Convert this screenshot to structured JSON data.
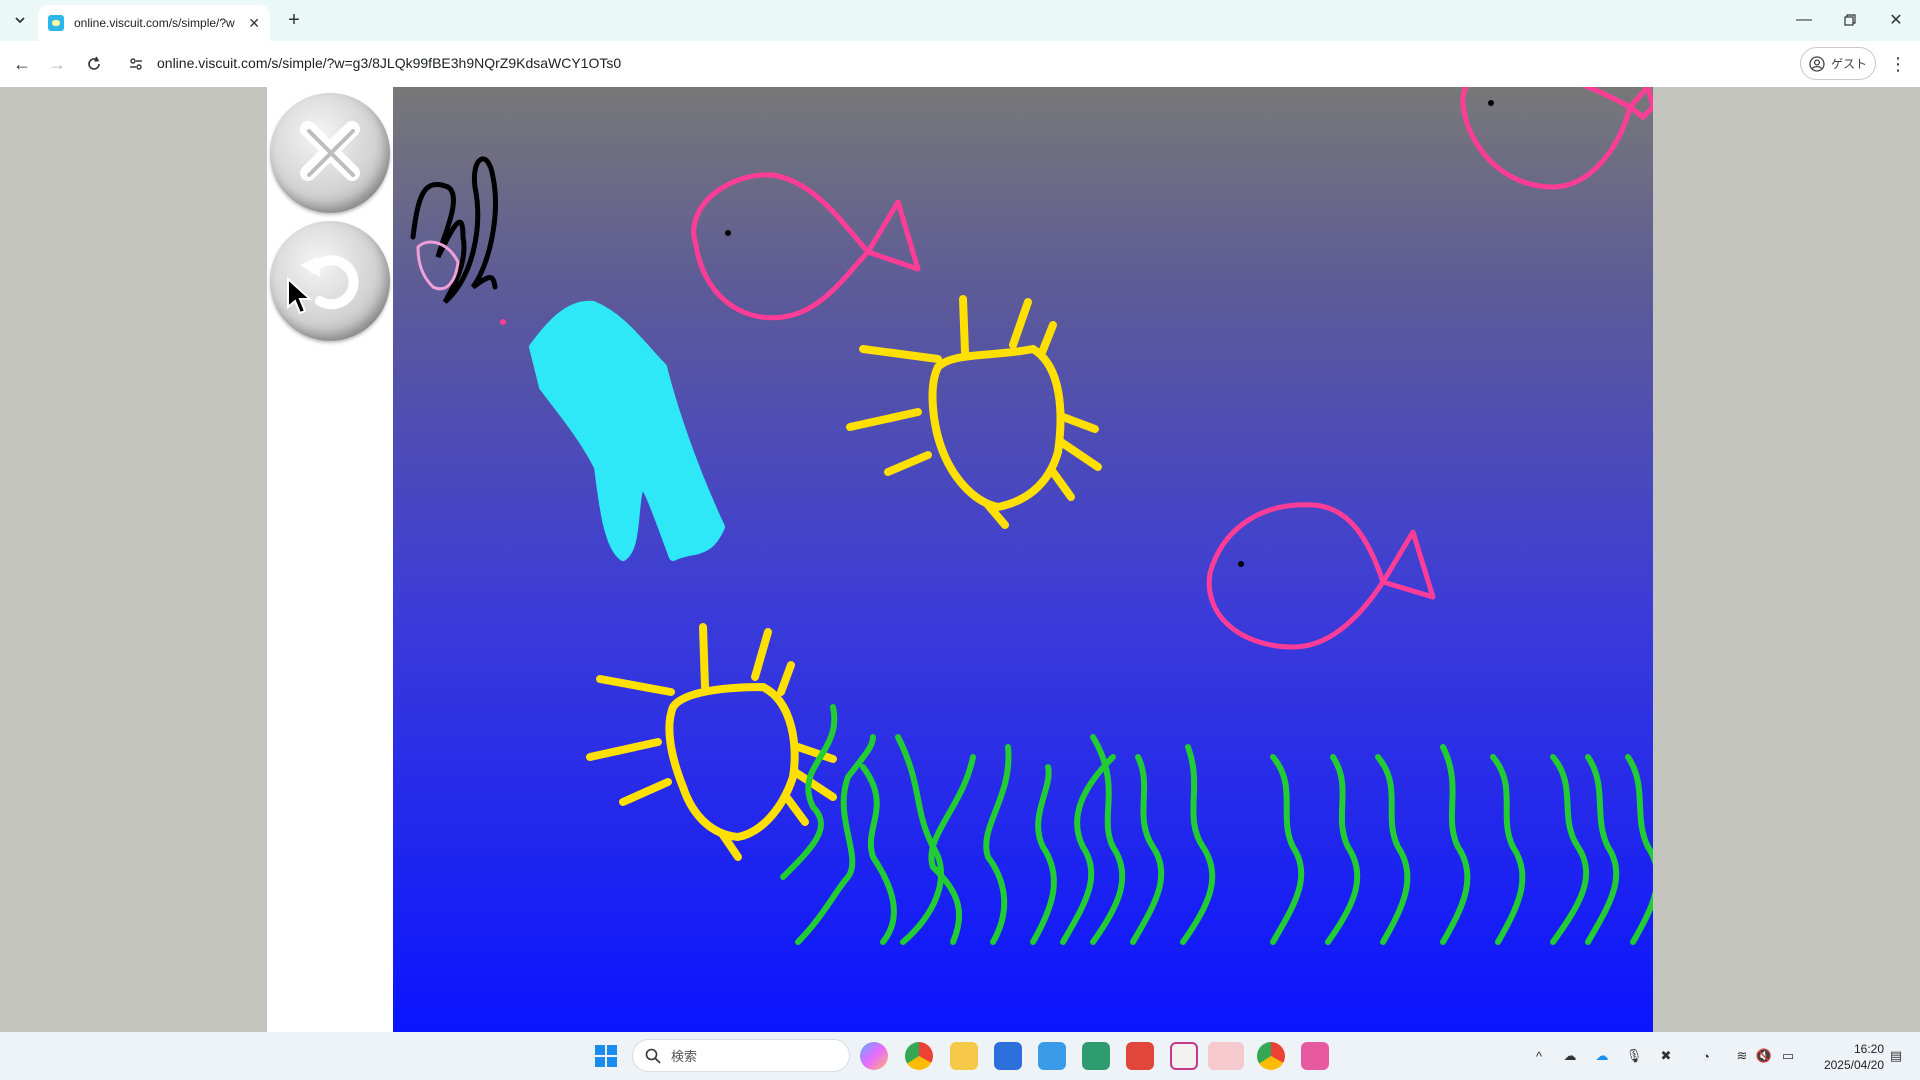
{
  "browser": {
    "tab_title": "online.viscuit.com/s/simple/?w",
    "url": "online.viscuit.com/s/simple/?w=g3/8JLQk99fBE3h9NQrZ9KdsaWCY1OTs0",
    "guest_label": "ゲスト"
  },
  "viscuit": {
    "close_button_icon": "close-icon",
    "restart_button_icon": "refresh-icon"
  },
  "taskbar": {
    "search_placeholder": "検索",
    "clock_time": "16:20",
    "clock_date": "2025/04/20"
  },
  "colors": {
    "fish": "#ff3d96",
    "sun": "#ffe000",
    "seaweed": "#22cc33",
    "jellyfish": "#2ee8f8",
    "canvas_top": "#787878",
    "canvas_bottom": "#0a14ff"
  }
}
